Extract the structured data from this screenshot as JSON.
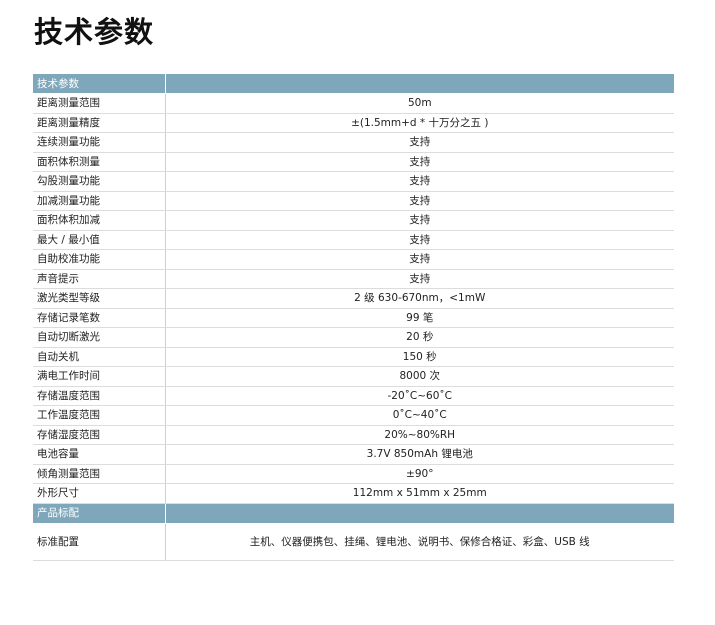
{
  "title": "技术参数",
  "sections": [
    {
      "header": "技术参数",
      "rows": [
        {
          "label": "距离测量范围",
          "value": "50m"
        },
        {
          "label": "距离测量精度",
          "value": "±(1.5mm+d * 十万分之五 )"
        },
        {
          "label": "连续测量功能",
          "value": "支持"
        },
        {
          "label": "面积体积测量",
          "value": "支持"
        },
        {
          "label": "勾股测量功能",
          "value": "支持"
        },
        {
          "label": "加减测量功能",
          "value": "支持"
        },
        {
          "label": "面积体积加减",
          "value": "支持"
        },
        {
          "label": "最大 / 最小值",
          "value": "支持"
        },
        {
          "label": "自助校准功能",
          "value": "支持"
        },
        {
          "label": "声音提示",
          "value": "支持"
        },
        {
          "label": "激光类型等级",
          "value": "2 级 630-670nm，<1mW"
        },
        {
          "label": "存储记录笔数",
          "value": "99 笔"
        },
        {
          "label": "自动切断激光",
          "value": "20 秒"
        },
        {
          "label": "自动关机",
          "value": "150 秒"
        },
        {
          "label": "满电工作时间",
          "value": "8000 次"
        },
        {
          "label": "存储温度范围",
          "value": "-20˚C~60˚C"
        },
        {
          "label": "工作温度范围",
          "value": "0˚C~40˚C"
        },
        {
          "label": "存储湿度范围",
          "value": "20%~80%RH"
        },
        {
          "label": "电池容量",
          "value": "3.7V 850mAh 锂电池"
        },
        {
          "label": "倾角测量范围",
          "value": "±90°"
        },
        {
          "label": "外形尺寸",
          "value": "112mm x 51mm x 25mm"
        }
      ]
    },
    {
      "header": "产品标配",
      "rows": [
        {
          "label": "标准配置",
          "value": "主机、仪器便携包、挂绳、锂电池、说明书、保修合格证、彩盒、USB 线"
        }
      ]
    }
  ]
}
